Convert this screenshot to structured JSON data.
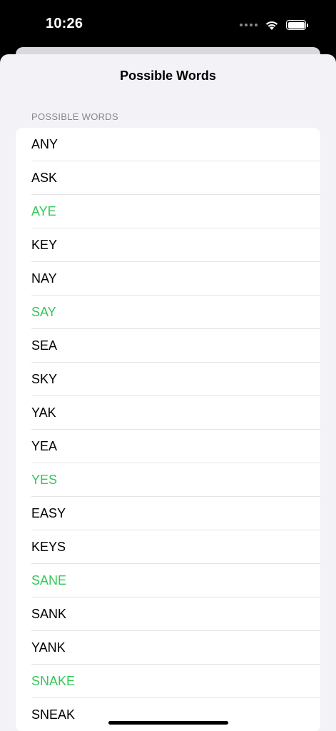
{
  "status_bar": {
    "time": "10:26",
    "icons": [
      "signal-dots-icon",
      "wifi-icon",
      "battery-icon"
    ]
  },
  "sheet": {
    "title": "Possible Words",
    "section_header": "POSSIBLE WORDS"
  },
  "colors": {
    "highlight": "#34c759",
    "normal": "#000000"
  },
  "words": [
    {
      "text": "ANY",
      "highlighted": false
    },
    {
      "text": "ASK",
      "highlighted": false
    },
    {
      "text": "AYE",
      "highlighted": true
    },
    {
      "text": "KEY",
      "highlighted": false
    },
    {
      "text": "NAY",
      "highlighted": false
    },
    {
      "text": "SAY",
      "highlighted": true
    },
    {
      "text": "SEA",
      "highlighted": false
    },
    {
      "text": "SKY",
      "highlighted": false
    },
    {
      "text": "YAK",
      "highlighted": false
    },
    {
      "text": "YEA",
      "highlighted": false
    },
    {
      "text": "YES",
      "highlighted": true
    },
    {
      "text": "EASY",
      "highlighted": false
    },
    {
      "text": "KEYS",
      "highlighted": false
    },
    {
      "text": "SANE",
      "highlighted": true
    },
    {
      "text": "SANK",
      "highlighted": false
    },
    {
      "text": "YANK",
      "highlighted": false
    },
    {
      "text": "SNAKE",
      "highlighted": true
    },
    {
      "text": "SNEAK",
      "highlighted": false
    }
  ]
}
